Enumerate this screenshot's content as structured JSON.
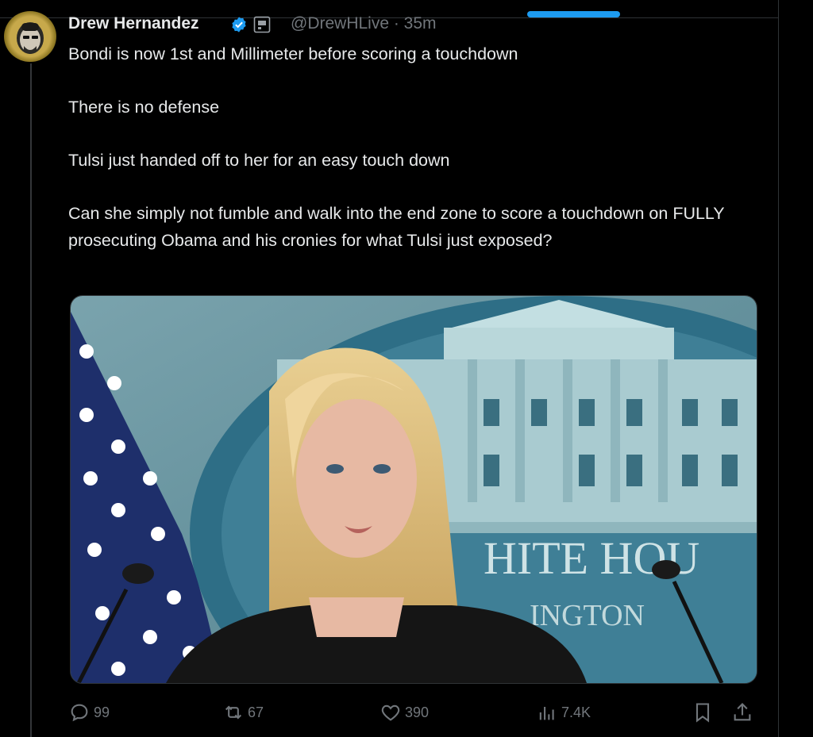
{
  "tweet": {
    "author": {
      "display_name": "Drew Hernandez",
      "handle_time": "@DrewHLive · 35m"
    },
    "paragraphs": [
      "Bondi is now 1st and Millimeter before scoring a touchdown",
      "There is no defense",
      "Tulsi just handed off to her for an easy touch down",
      "Can she simply not fumble and walk into the end zone to score a touchdown on FULLY prosecuting Obama and his cronies for what Tulsi just exposed?"
    ],
    "media": {
      "sign_line1": "HITE HOU",
      "sign_line2": "INGTON"
    },
    "stats": {
      "replies": "99",
      "reposts": "67",
      "likes": "390",
      "views": "7.4K"
    }
  },
  "icons": {
    "verified": "verified-badge-icon",
    "affiliate": "affiliate-badge-icon",
    "grok": "grok-icon",
    "more": "more-icon",
    "reply": "reply-icon",
    "repost": "repost-icon",
    "like": "heart-icon",
    "views": "views-icon",
    "bookmark": "bookmark-icon",
    "share": "share-icon"
  },
  "colors": {
    "background": "#000000",
    "text": "#e7e9ea",
    "secondary_text": "#71767b",
    "accent": "#1d9bf0"
  }
}
